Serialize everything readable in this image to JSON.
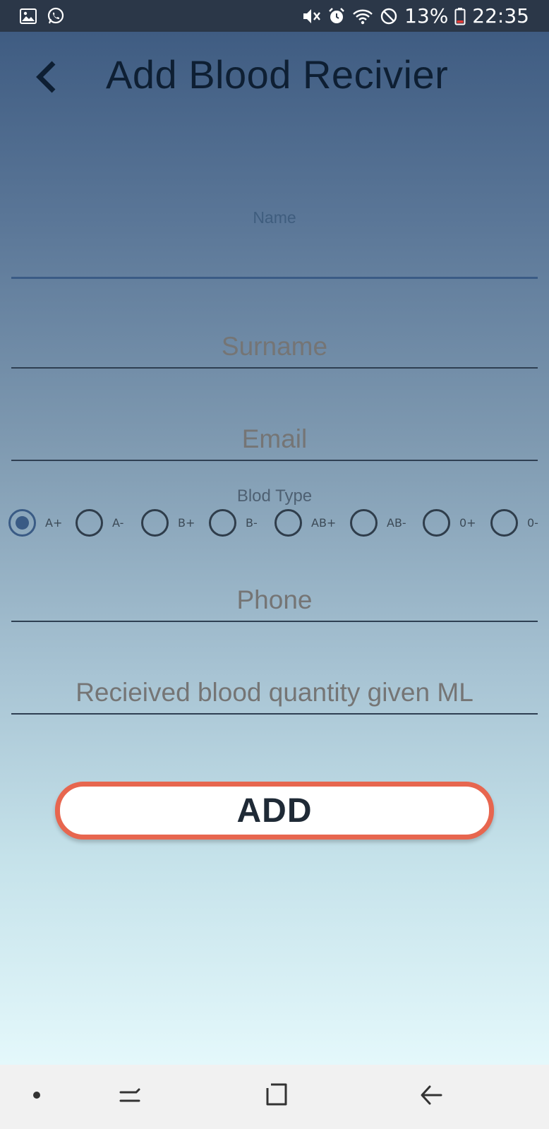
{
  "status_bar": {
    "battery": "13%",
    "time": "22:35",
    "left_icons": [
      "gallery-icon",
      "whatsapp-icon"
    ],
    "right_icons": [
      "mute-icon",
      "alarm-icon",
      "wifi-icon",
      "do-not-disturb-icon",
      "battery-icon"
    ]
  },
  "header": {
    "title": "Add Blood Recivier",
    "back_icon": "chevron-left-icon"
  },
  "form": {
    "name": {
      "label": "Name",
      "value": ""
    },
    "surname": {
      "placeholder": "Surname"
    },
    "email": {
      "placeholder": "Email"
    },
    "blood_type": {
      "label": "Blod Type",
      "selected": "A+",
      "options": [
        "A+",
        "A-",
        "B+",
        "B-",
        "AB+",
        "AB-",
        "0+",
        "0-"
      ]
    },
    "phone": {
      "placeholder": "Phone"
    },
    "quantity": {
      "placeholder": "Recieived blood quantity given ML"
    }
  },
  "add_button": {
    "label": "ADD"
  },
  "colors": {
    "accent": "#e7664f",
    "primary": "#3a5b85",
    "title": "#0e1f33"
  },
  "nav_bar": {
    "items": [
      "dot-icon",
      "recent-apps-icon",
      "home-icon",
      "back-icon"
    ]
  }
}
